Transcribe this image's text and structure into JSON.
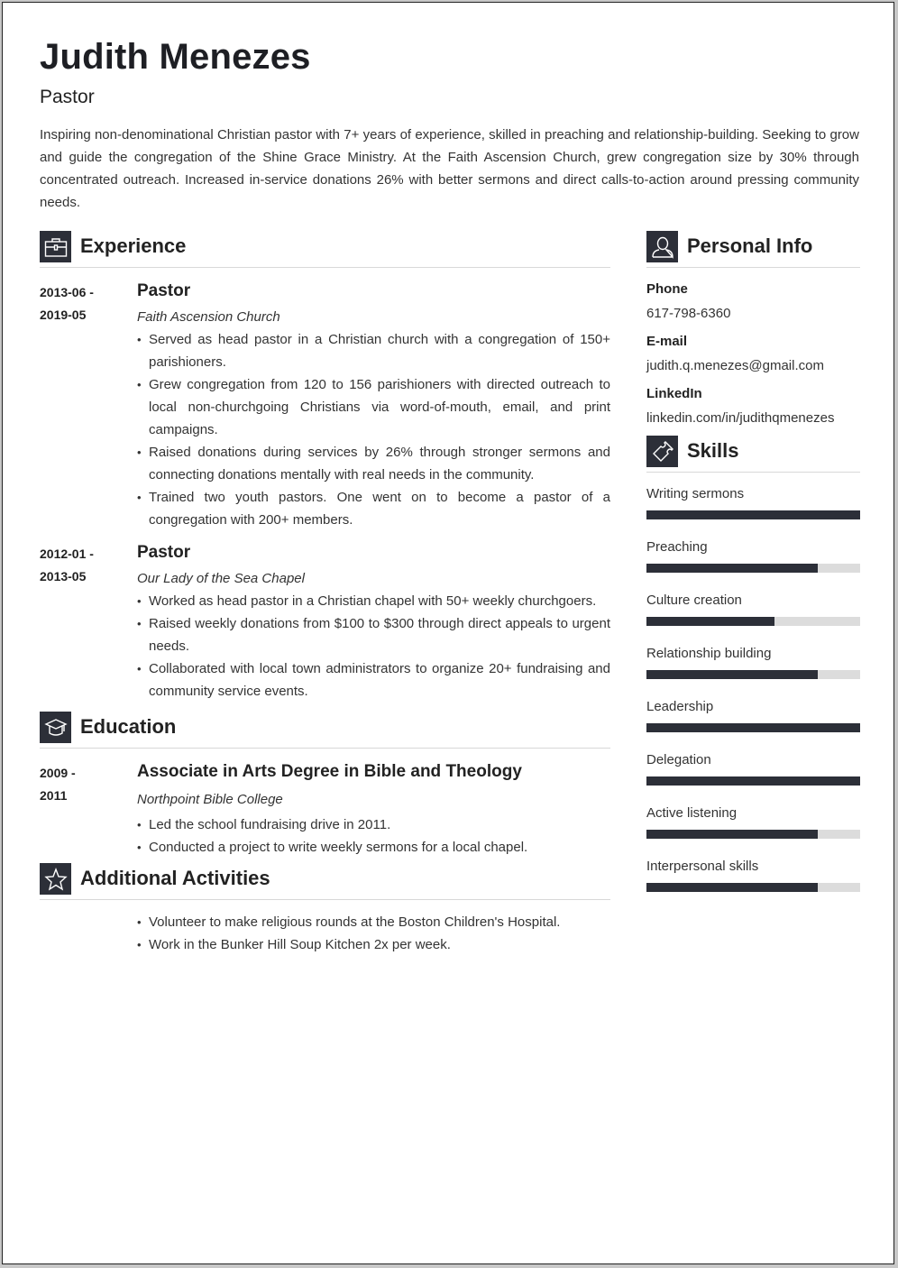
{
  "header": {
    "name": "Judith Menezes",
    "title": "Pastor",
    "summary": "Inspiring non-denominational Christian pastor with 7+ years of experience, skilled in preaching and relationship-building. Seeking to grow and guide the congregation of the Shine Grace Ministry. At the Faith Ascension Church, grew congregation size by 30% through concentrated outreach. Increased in-service donations 26% with better sermons and direct calls-to-action around pressing community needs."
  },
  "colors": {
    "accent": "#2c2f38",
    "bar_track": "#dcdcdc"
  },
  "experience": {
    "heading": "Experience",
    "icon": "briefcase-icon",
    "entries": [
      {
        "date_start": "2013-06 -",
        "date_end": "2019-05",
        "role": "Pastor",
        "org": "Faith Ascension Church",
        "bullets": [
          "Served as head pastor in a Christian church with a congregation of 150+ parishioners.",
          "Grew congregation from 120 to 156 parishioners with directed outreach to local non-churchgoing Christians via word-of-mouth, email, and print campaigns.",
          "Raised donations during services by 26% through stronger sermons and connecting donations mentally with real needs in the community.",
          "Trained two youth pastors. One went on to become a pastor of a congregation with 200+ members."
        ]
      },
      {
        "date_start": "2012-01 -",
        "date_end": "2013-05",
        "role": "Pastor",
        "org": "Our Lady of the Sea Chapel",
        "bullets": [
          "Worked as head pastor in a Christian chapel with 50+ weekly churchgoers.",
          "Raised weekly donations from $100 to $300 through direct appeals to urgent needs.",
          "Collaborated with local town administrators to organize 20+ fundraising and community service events."
        ]
      }
    ]
  },
  "education": {
    "heading": "Education",
    "icon": "graduation-cap-icon",
    "entries": [
      {
        "date_start": "2009 -",
        "date_end": "2011",
        "degree": "Associate in Arts Degree in Bible and Theology",
        "school": "Northpoint Bible College",
        "bullets": [
          "Led the school fundraising drive in 2011.",
          "Conducted a project to write weekly sermons for a local chapel."
        ]
      }
    ]
  },
  "activities": {
    "heading": "Additional Activities",
    "icon": "star-icon",
    "bullets": [
      "Volunteer to make religious rounds at the Boston Children's Hospital.",
      "Work in the Bunker Hill Soup Kitchen 2x per week."
    ]
  },
  "personal_info": {
    "heading": "Personal Info",
    "icon": "user-icon",
    "phone_label": "Phone",
    "phone": "617-798-6360",
    "email_label": "E-mail",
    "email": "judith.q.menezes@gmail.com",
    "linkedin_label": "LinkedIn",
    "linkedin": "linkedin.com/in/judithqmenezes"
  },
  "skills": {
    "heading": "Skills",
    "icon": "puzzle-icon",
    "items": [
      {
        "name": "Writing sermons",
        "level": 1.0
      },
      {
        "name": "Preaching",
        "level": 0.8
      },
      {
        "name": "Culture creation",
        "level": 0.6
      },
      {
        "name": "Relationship building",
        "level": 0.8
      },
      {
        "name": "Leadership",
        "level": 1.0
      },
      {
        "name": "Delegation",
        "level": 1.0
      },
      {
        "name": "Active listening",
        "level": 0.8
      },
      {
        "name": "Interpersonal skills",
        "level": 0.8
      }
    ]
  }
}
